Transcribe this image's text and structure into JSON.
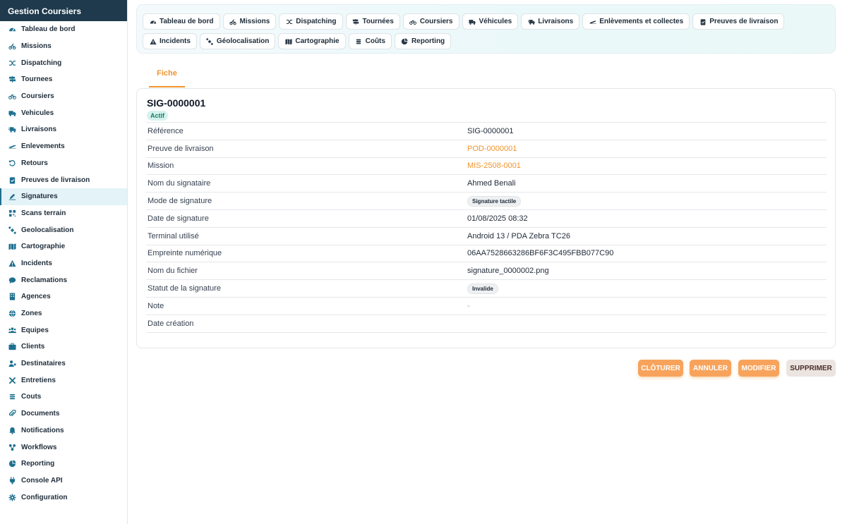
{
  "sidebar": {
    "title": "Gestion Coursiers",
    "items": [
      {
        "label": "Tableau de bord",
        "icon": "dashboard-icon"
      },
      {
        "label": "Missions",
        "icon": "bike-icon"
      },
      {
        "label": "Dispatching",
        "icon": "shuffle-icon"
      },
      {
        "label": "Tournees",
        "icon": "signpost-icon"
      },
      {
        "label": "Coursiers",
        "icon": "bicycle-icon"
      },
      {
        "label": "Vehicules",
        "icon": "truck-icon"
      },
      {
        "label": "Livraisons",
        "icon": "truck-fast-icon"
      },
      {
        "label": "Enlevements",
        "icon": "plane-icon"
      },
      {
        "label": "Retours",
        "icon": "undo-icon"
      },
      {
        "label": "Preuves de livraison",
        "icon": "clipboard-check-icon"
      },
      {
        "label": "Signatures",
        "icon": "signature-icon"
      },
      {
        "label": "Scans terrain",
        "icon": "qrcode-icon"
      },
      {
        "label": "Geolocalisation",
        "icon": "satellite-icon"
      },
      {
        "label": "Cartographie",
        "icon": "map-icon"
      },
      {
        "label": "Incidents",
        "icon": "warning-icon"
      },
      {
        "label": "Reclamations",
        "icon": "comment-icon"
      },
      {
        "label": "Agences",
        "icon": "building-icon"
      },
      {
        "label": "Zones",
        "icon": "globe-icon"
      },
      {
        "label": "Equipes",
        "icon": "users-icon"
      },
      {
        "label": "Clients",
        "icon": "briefcase-icon"
      },
      {
        "label": "Destinataires",
        "icon": "user-tag-icon"
      },
      {
        "label": "Entretiens",
        "icon": "tools-icon"
      },
      {
        "label": "Couts",
        "icon": "coins-icon"
      },
      {
        "label": "Documents",
        "icon": "paperclip-icon"
      },
      {
        "label": "Notifications",
        "icon": "bell-icon"
      },
      {
        "label": "Workflows",
        "icon": "workflow-icon"
      },
      {
        "label": "Reporting",
        "icon": "pie-chart-icon"
      },
      {
        "label": "Console API",
        "icon": "plug-icon"
      },
      {
        "label": "Configuration",
        "icon": "gear-icon"
      }
    ],
    "active_label": "Signatures"
  },
  "tabs": [
    {
      "label": "Tableau de bord",
      "icon": "dashboard-icon"
    },
    {
      "label": "Missions",
      "icon": "bike-icon"
    },
    {
      "label": "Dispatching",
      "icon": "shuffle-icon"
    },
    {
      "label": "Tournées",
      "icon": "signpost-icon"
    },
    {
      "label": "Coursiers",
      "icon": "bicycle-icon"
    },
    {
      "label": "Véhicules",
      "icon": "truck-icon"
    },
    {
      "label": "Livraisons",
      "icon": "truck-fast-icon"
    },
    {
      "label": "Enlèvements et collectes",
      "icon": "plane-icon"
    },
    {
      "label": "Preuves de livraison",
      "icon": "clipboard-check-icon"
    },
    {
      "label": "Incidents",
      "icon": "warning-icon"
    },
    {
      "label": "Géolocalisation",
      "icon": "satellite-icon"
    },
    {
      "label": "Cartographie",
      "icon": "map-icon"
    },
    {
      "label": "Coûts",
      "icon": "coins-icon"
    },
    {
      "label": "Reporting",
      "icon": "pie-chart-icon"
    }
  ],
  "detail_tab": {
    "label": "Fiche"
  },
  "record": {
    "title": "SIG-0000001",
    "status_badge": "Actif",
    "fields": [
      {
        "label": "Référence",
        "value": "SIG-0000001",
        "style": "text"
      },
      {
        "label": "Preuve de livraison",
        "value": "POD-0000001",
        "style": "link"
      },
      {
        "label": "Mission",
        "value": "MIS-2508-0001",
        "style": "link"
      },
      {
        "label": "Nom du signataire",
        "value": "Ahmed Benali",
        "style": "text"
      },
      {
        "label": "Mode de signature",
        "value": "Signature tactile",
        "style": "pill"
      },
      {
        "label": "Date de signature",
        "value": "01/08/2025 08:32",
        "style": "text"
      },
      {
        "label": "Terminal utilisé",
        "value": "Android 13 / PDA Zebra TC26",
        "style": "text"
      },
      {
        "label": "Empreinte numérique",
        "value": "06AA7528663286BF6F3C495FBB077C90",
        "style": "text"
      },
      {
        "label": "Nom du fichier",
        "value": "signature_0000002.png",
        "style": "text"
      },
      {
        "label": "Statut de la signature",
        "value": "Invalide",
        "style": "pill"
      },
      {
        "label": "Note",
        "value": "-",
        "style": "muted"
      },
      {
        "label": "Date création",
        "value": "",
        "style": "text"
      }
    ]
  },
  "actions": {
    "close_label": "CLÔTURER",
    "cancel_label": "ANNULER",
    "edit_label": "MODIFIER",
    "delete_label": "SUPPRIMER"
  },
  "colors": {
    "accent": "#f0942c",
    "sidebar_header": "#1e3a4c",
    "icon": "#1e6f8f",
    "badge_bg": "#d6f2ec",
    "badge_text": "#12806a"
  }
}
